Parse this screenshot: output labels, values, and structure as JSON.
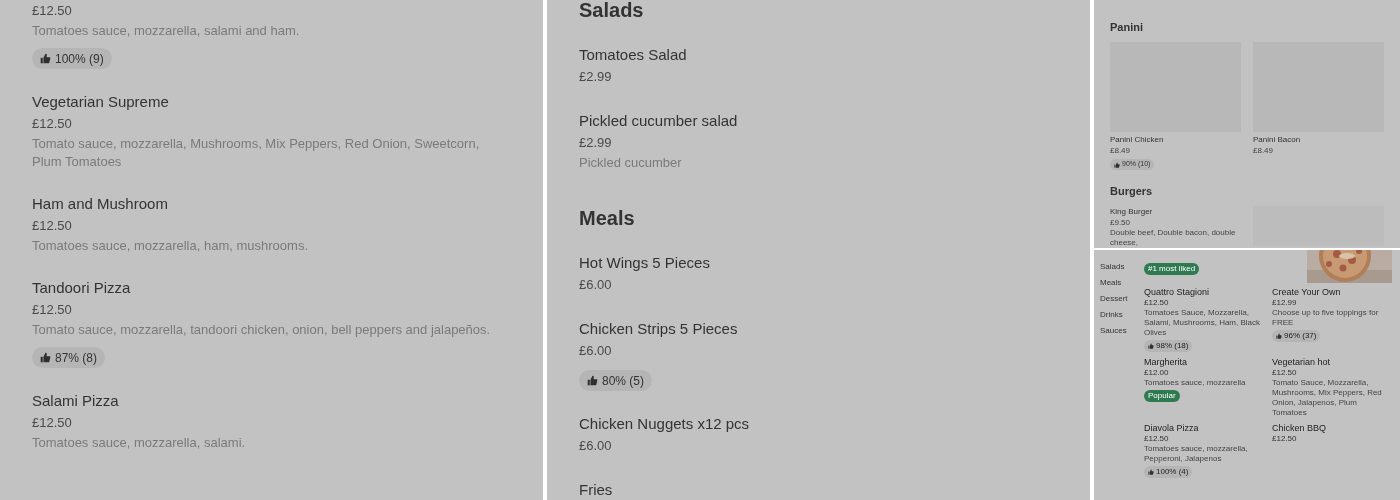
{
  "panels": [
    {
      "kind": "list",
      "sections": [
        {
          "items": [
            {
              "price": "£12.50",
              "description": "Tomatoes sauce, mozzarella, salami and ham.",
              "rating": "100% (9)"
            },
            {
              "name": "Vegetarian Supreme",
              "price": "£12.50",
              "description": "Tomato sauce, mozzarella, Mushrooms, Mix Peppers, Red Onion, Sweetcorn, Plum Tomatoes"
            },
            {
              "name": "Ham and Mushroom",
              "price": "£12.50",
              "description": "Tomatoes sauce, mozzarella, ham, mushrooms."
            },
            {
              "name": "Tandoori Pizza",
              "price": "£12.50",
              "description": "Tomato sauce, mozzarella, tandoori chicken, onion, bell peppers and jalapeños.",
              "rating": "87% (8)"
            },
            {
              "name": "Salami Pizza",
              "price": "£12.50",
              "description": "Tomatoes sauce, mozzarella, salami."
            }
          ]
        }
      ]
    },
    {
      "kind": "list",
      "sections": [
        {
          "title": "Salads",
          "items": [
            {
              "name": "Tomatoes Salad",
              "price": "£2.99"
            },
            {
              "name": "Pickled cucumber salad",
              "price": "£2.99",
              "description": "Pickled cucumber"
            }
          ]
        },
        {
          "title": "Meals",
          "items": [
            {
              "name": "Hot Wings 5 Pieces",
              "price": "£6.00"
            },
            {
              "name": "Chicken Strips 5 Pieces",
              "price": "£6.00",
              "rating": "80% (5)"
            },
            {
              "name": "Chicken Nuggets x12 pcs",
              "price": "£6.00"
            },
            {
              "name": "Fries"
            }
          ]
        }
      ]
    },
    {
      "kind": "grid",
      "sections": [
        {
          "title": "Panini",
          "items": [
            {
              "name": "Panini Chicken",
              "price": "£8.49",
              "rating": "90% (10)"
            },
            {
              "name": "Panini Bacon",
              "price": "£8.49"
            }
          ]
        },
        {
          "title": "Burgers",
          "items": [
            {
              "name": "King Burger",
              "price": "£9.50",
              "description": "Double beef, Double bacon, double cheese,"
            }
          ]
        }
      ]
    },
    {
      "kind": "mini",
      "sidebar": [
        "Salads",
        "Meals",
        "Dessert",
        "Drinks",
        "Sauces"
      ],
      "top_badge": "#1 most liked",
      "items": [
        {
          "name": "Quattro Stagioni",
          "price": "£12.50",
          "description": "Tomatoes Sauce, Mozzarella, Salami, Mushrooms, Ham, Black Olives",
          "rating": "98% (18)"
        },
        {
          "name": "Create Your Own",
          "price": "£12.99",
          "description": "Choose up to five toppings for FREE",
          "rating": "96% (37)"
        },
        {
          "name": "Margherita",
          "price": "£12.00",
          "description": "Tomatoes sauce, mozzarella",
          "badge": "Popular"
        },
        {
          "name": "Vegetarian hot",
          "price": "£12.50",
          "description": "Tomato Sauce, Mozzarella, Mushrooms, Mix Peppers, Red Onion, Jalapenos, Plum Tomatoes"
        },
        {
          "name": "Diavola Pizza",
          "price": "£12.50",
          "description": "Tomatoes sauce, mozzarella, Pepperoni, Jalapenos",
          "rating": "100% (4)"
        },
        {
          "name": "Chicken BBQ",
          "price": "£12.50"
        }
      ]
    }
  ]
}
